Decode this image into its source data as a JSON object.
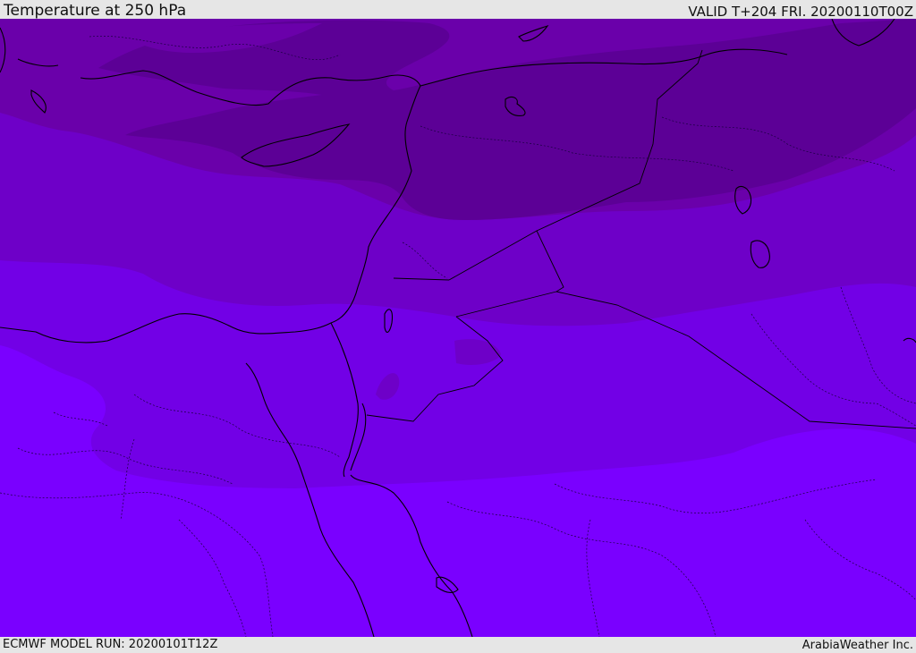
{
  "header": {
    "title": "Temperature at 250 hPa",
    "valid_time": "VALID T+204 FRI. 20200110T00Z"
  },
  "footer": {
    "model_run": "ECMWF MODEL RUN: 20200101T12Z",
    "credit": "ArabiaWeather Inc."
  },
  "colors": {
    "band_coldest": "#5c0096",
    "band_cold": "#6a00aa",
    "band_mid": "#6e00c8",
    "band_warm": "#7200e6",
    "band_warmest": "#7a00ff",
    "coastline": "#000000",
    "borders": "#1a0040"
  }
}
